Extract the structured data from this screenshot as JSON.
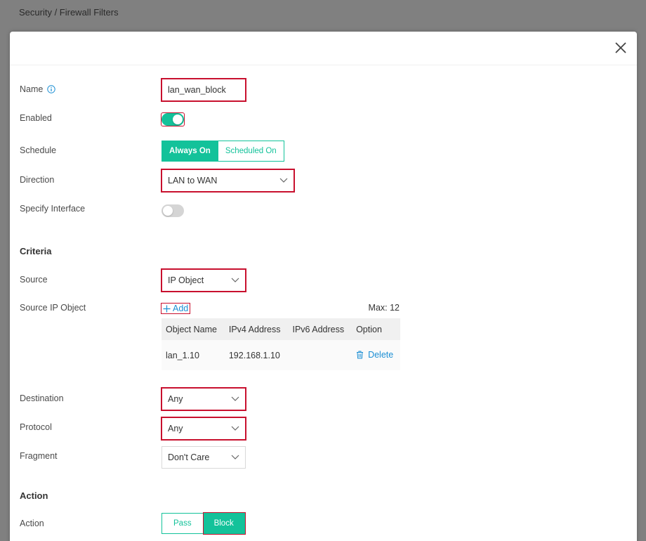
{
  "breadcrumb": "Security / Firewall Filters",
  "form": {
    "name_label": "Name",
    "name_value": "lan_wan_block",
    "enabled_label": "Enabled",
    "enabled": true,
    "schedule_label": "Schedule",
    "schedule_options": [
      "Always On",
      "Scheduled On"
    ],
    "schedule_selected": "Always On",
    "direction_label": "Direction",
    "direction_value": "LAN to WAN",
    "specify_interface_label": "Specify Interface",
    "specify_interface": false
  },
  "criteria": {
    "title": "Criteria",
    "source_label": "Source",
    "source_value": "IP Object",
    "source_ip_object_label": "Source IP Object",
    "add_label": "Add",
    "max_label": "Max: 12",
    "table": {
      "headers": [
        "Object Name",
        "IPv4 Address",
        "IPv6 Address",
        "Option"
      ],
      "rows": [
        {
          "name": "lan_1.10",
          "ipv4": "192.168.1.10",
          "ipv6": "",
          "option": "Delete"
        }
      ]
    },
    "destination_label": "Destination",
    "destination_value": "Any",
    "protocol_label": "Protocol",
    "protocol_value": "Any",
    "fragment_label": "Fragment",
    "fragment_value": "Don't Care"
  },
  "action": {
    "title": "Action",
    "action_label": "Action",
    "options": [
      "Pass",
      "Block"
    ],
    "selected": "Block"
  },
  "colors": {
    "accent": "#13c29a",
    "link": "#1c8fd4",
    "highlight": "#c8102e"
  }
}
